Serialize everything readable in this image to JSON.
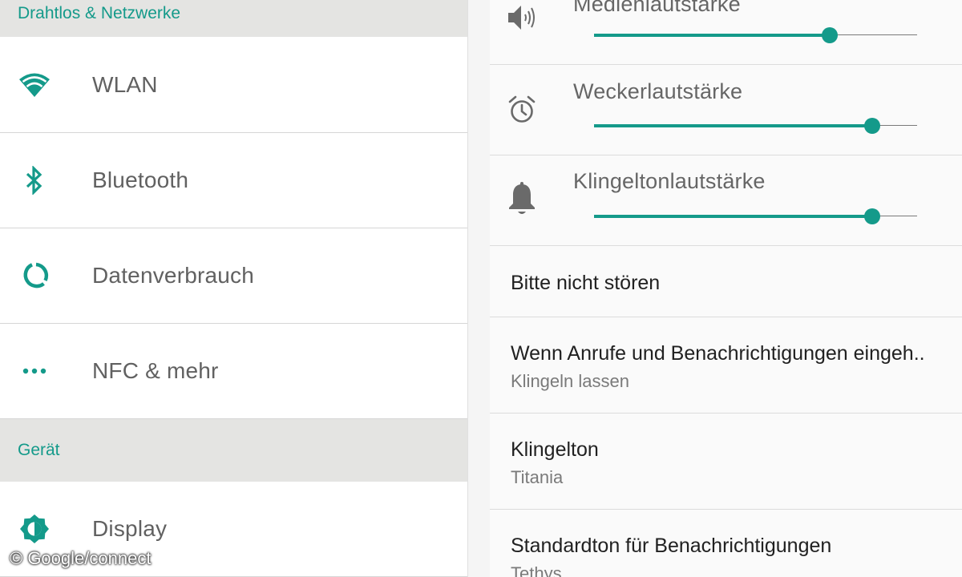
{
  "left": {
    "sections": [
      {
        "header": "Drahtlos & Netzwerke"
      },
      {
        "header": "Gerät"
      }
    ],
    "items": [
      {
        "label": "WLAN",
        "icon": "wifi-icon"
      },
      {
        "label": "Bluetooth",
        "icon": "bluetooth-icon"
      },
      {
        "label": "Datenverbrauch",
        "icon": "data-usage-icon"
      },
      {
        "label": "NFC & mehr",
        "icon": "more-dots-icon"
      },
      {
        "label": "Display",
        "icon": "brightness-icon"
      }
    ]
  },
  "right": {
    "volumes": [
      {
        "label": "Medienlautstärke",
        "icon": "speaker-icon",
        "level": 0.73
      },
      {
        "label": "Weckerlautstärke",
        "icon": "alarm-clock-icon",
        "level": 0.86
      },
      {
        "label": "Klingeltonlautstärke",
        "icon": "bell-icon",
        "level": 0.86
      }
    ],
    "prefs": [
      {
        "title": "Bitte nicht stören",
        "subtitle": ""
      },
      {
        "title": "Wenn Anrufe und Benachrichtigungen eingeh..",
        "subtitle": "Klingeln lassen"
      },
      {
        "title": "Klingelton",
        "subtitle": "Titania"
      },
      {
        "title": "Standardton für Benachrichtigungen",
        "subtitle": "Tethys"
      }
    ]
  },
  "colors": {
    "accent": "#149a8a",
    "header_bg": "#e4e4e2"
  },
  "watermark": "© Google/connect"
}
